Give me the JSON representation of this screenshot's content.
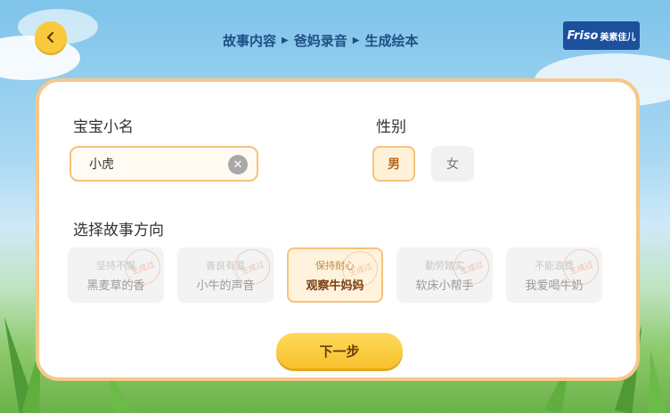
{
  "header": {
    "back_icon": "chevron-left-icon",
    "steps": [
      "故事内容",
      "爸妈录音",
      "生成绘本"
    ],
    "logo": {
      "en": "Friso",
      "cn": "美素佳儿"
    }
  },
  "form": {
    "name_label": "宝宝小名",
    "name_value": "小虎",
    "gender_label": "性别",
    "gender_options": [
      "男",
      "女"
    ],
    "gender_selected": "男",
    "story_label": "选择故事方向",
    "stories": [
      {
        "tag": "坚持不懈",
        "title": "黑麦草的香",
        "stamp": "生成过",
        "selected": false
      },
      {
        "tag": "善良有爱",
        "title": "小牛的声音",
        "stamp": "生成过",
        "selected": false
      },
      {
        "tag": "保持耐心",
        "title": "观察牛妈妈",
        "stamp": "生成过",
        "selected": true
      },
      {
        "tag": "勤劳踏实",
        "title": "软床小帮手",
        "stamp": "生成过",
        "selected": false
      },
      {
        "tag": "不能浪费",
        "title": "我爱喝牛奶",
        "stamp": "生成过",
        "selected": false
      }
    ],
    "next_label": "下一步"
  },
  "colors": {
    "accent": "#f7c12e",
    "border": "#f7c88a",
    "title": "#1f4f86"
  }
}
